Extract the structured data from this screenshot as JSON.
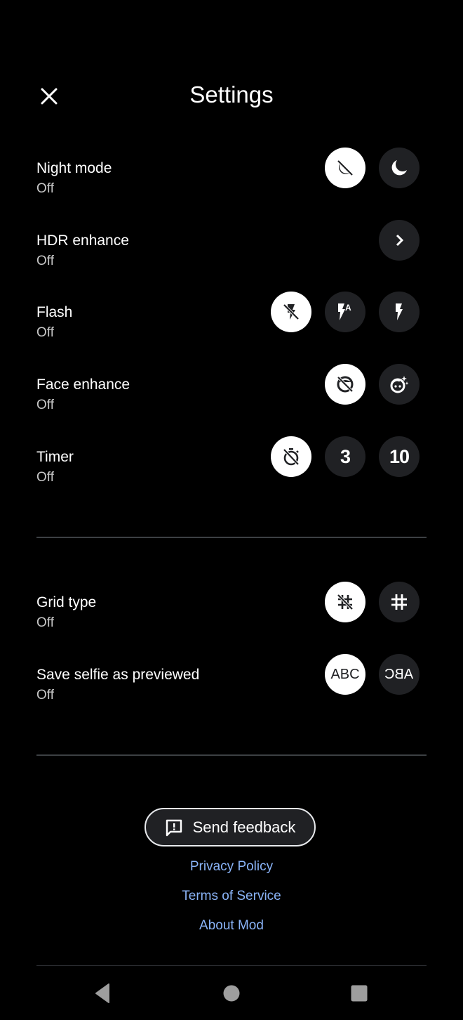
{
  "header": {
    "title": "Settings",
    "close_icon": "close-icon"
  },
  "colors": {
    "background": "#000000",
    "chip": "#202124",
    "chip_selected": "#ffffff",
    "link": "#8ab4f8",
    "divider": "#3c4043",
    "secondary_text": "#c8c8c8"
  },
  "settings": [
    {
      "label": "Night mode",
      "value": "Off",
      "options": [
        {
          "icon": "night-mode-off-icon",
          "selected": true
        },
        {
          "icon": "moon-icon",
          "selected": false
        }
      ]
    },
    {
      "label": "HDR enhance",
      "value": "Off",
      "options": [
        {
          "icon": "chevron-right-icon",
          "selected": false
        }
      ]
    },
    {
      "label": "Flash",
      "value": "Off",
      "options": [
        {
          "icon": "flash-off-icon",
          "selected": true
        },
        {
          "icon": "flash-auto-icon",
          "selected": false
        },
        {
          "icon": "flash-on-icon",
          "selected": false
        }
      ]
    },
    {
      "label": "Face enhance",
      "value": "Off",
      "options": [
        {
          "icon": "face-retouch-off-icon",
          "selected": true
        },
        {
          "icon": "face-retouch-icon",
          "selected": false
        }
      ]
    },
    {
      "label": "Timer",
      "value": "Off",
      "options": [
        {
          "icon": "timer-off-icon",
          "selected": true
        },
        {
          "icon": "timer-3-icon",
          "text": "3",
          "selected": false
        },
        {
          "icon": "timer-10-icon",
          "text": "10",
          "selected": false
        }
      ]
    },
    {
      "label": "Grid type",
      "value": "Off",
      "options": [
        {
          "icon": "grid-off-icon",
          "selected": true
        },
        {
          "icon": "grid-icon",
          "selected": false
        }
      ]
    },
    {
      "label": "Save selfie as previewed",
      "value": "Off",
      "options": [
        {
          "icon": "abc-icon",
          "text": "ABC",
          "selected": true
        },
        {
          "icon": "abc-mirrored-icon",
          "text": "ABC",
          "selected": false
        }
      ]
    }
  ],
  "footer": {
    "feedback_label": "Send feedback",
    "feedback_icon": "feedback-icon",
    "links": [
      "Privacy Policy",
      "Terms of Service",
      "About Mod"
    ]
  },
  "navbar": {
    "back": "back-icon",
    "home": "home-icon",
    "recents": "recents-icon"
  }
}
